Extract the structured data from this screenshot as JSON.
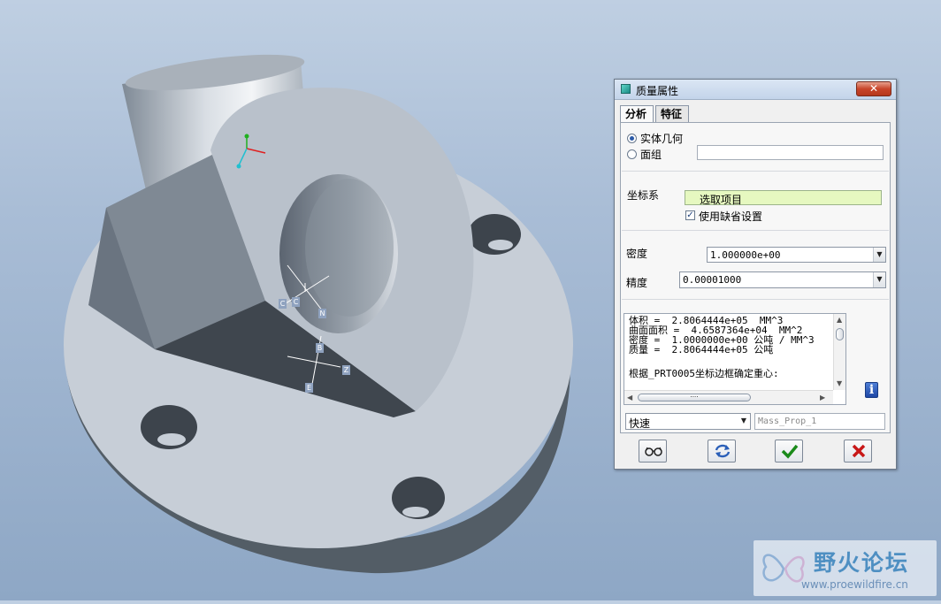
{
  "dialog": {
    "title": "质量属性",
    "tabs": [
      {
        "label": "分析"
      },
      {
        "label": "特征"
      }
    ],
    "geometry": {
      "option_solid": "实体几何",
      "option_quilt": "面组",
      "quilt_value": ""
    },
    "coord_sys": {
      "label": "坐标系",
      "select_value": "选取项目",
      "use_default_label": "使用缺省设置",
      "use_default_checked": true
    },
    "density": {
      "label": "密度",
      "value": "1.000000e+00"
    },
    "accuracy": {
      "label": "精度",
      "value": "0.00001000"
    },
    "results": [
      "体积 =  2.8064444e+05  MM^3",
      "曲面面积 =  4.6587364e+04  MM^2",
      "密度 =  1.0000000e+00 公吨 / MM^3",
      "质量 =  2.8064444e+05 公吨",
      "",
      "根据_PRT0005坐标边框确定重心:"
    ],
    "mode": {
      "value": "快速"
    },
    "name_field": {
      "value": "Mass_Prop_1"
    },
    "buttons": {
      "preview_icon": "glasses-icon",
      "recompute_icon": "regenerate-icon",
      "ok_icon": "checkmark-icon",
      "cancel_icon": "x-icon"
    },
    "colors": {
      "ok": "#1a8a1a",
      "cancel": "#c81818",
      "select_bg": "#e6f8c0"
    }
  },
  "viewport": {
    "csys_labels": [
      "C",
      "C",
      "N",
      "B",
      "Z",
      "E"
    ]
  },
  "watermark": {
    "title": "野火论坛",
    "url": "www.proewildfire.cn"
  }
}
